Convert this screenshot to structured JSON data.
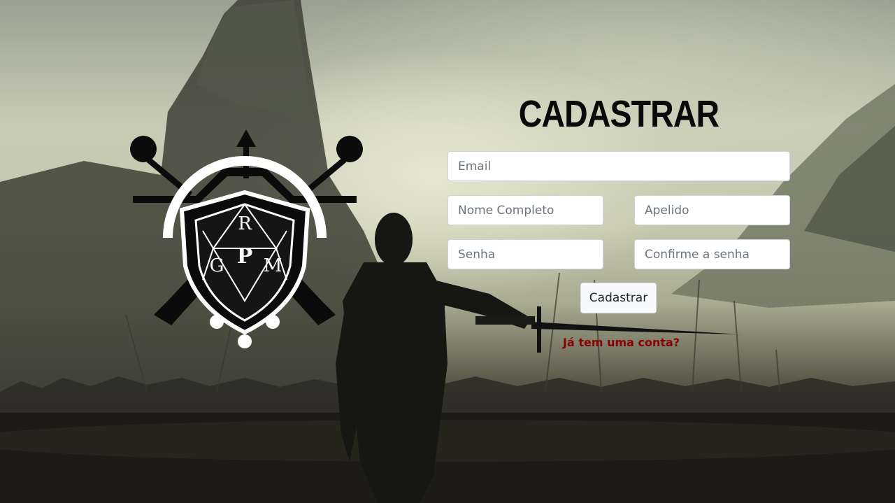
{
  "form": {
    "title": "CADASTRAR",
    "email_placeholder": "Email",
    "fullname_placeholder": "Nome Completo",
    "nickname_placeholder": "Apelido",
    "password_placeholder": "Senha",
    "confirm_password_placeholder": "Confirme a senha",
    "submit_label": "Cadastrar",
    "login_link_label": "Já tem uma conta?"
  },
  "logo": {
    "letters": [
      "R",
      "G",
      "P",
      "M"
    ]
  },
  "colors": {
    "title": "#0a0a0a",
    "link": "#8b0000",
    "button_bg": "#f8f9fa"
  }
}
